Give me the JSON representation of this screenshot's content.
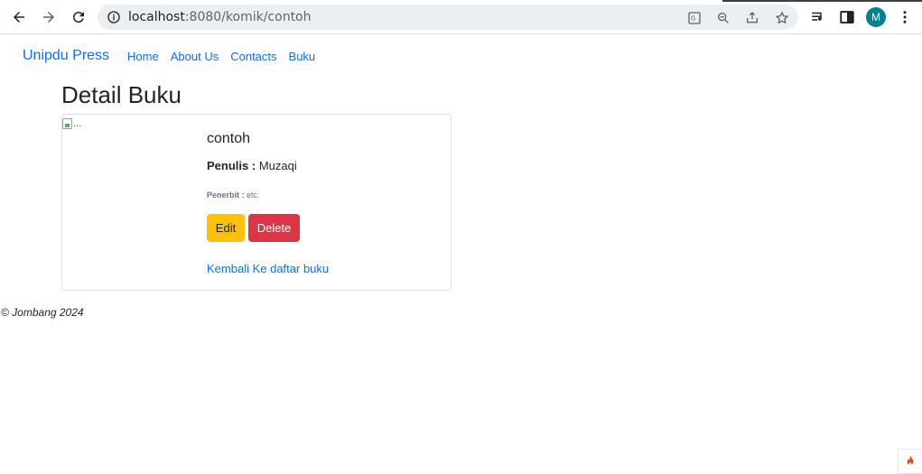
{
  "browser": {
    "url_host": "localhost",
    "url_rest": ":8080/komik/contoh",
    "profile_initial": "M"
  },
  "navbar": {
    "brand": "Unipdu Press",
    "links": [
      "Home",
      "About Us",
      "Contacts",
      "Buku"
    ]
  },
  "page": {
    "title": "Detail Buku"
  },
  "book": {
    "image_alt": "...",
    "title": "contoh",
    "author_label": "Penulis :",
    "author": "Muzaqi",
    "publisher_label": "Penerbit :",
    "publisher": "etc",
    "edit_label": "Edit",
    "delete_label": "Delete",
    "back_link": "Kembali Ke daftar buku"
  },
  "footer": {
    "text": "© Jombang 2024"
  },
  "colors": {
    "primary": "#0d6efd",
    "warning": "#ffc107",
    "danger": "#dc3545"
  }
}
